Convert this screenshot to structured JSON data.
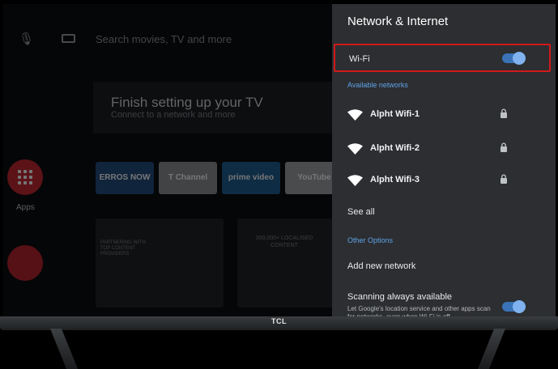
{
  "home": {
    "search_placeholder": "Search movies, TV and more",
    "setup_title": "Finish setting up your TV",
    "setup_subtitle": "Connect to a network and more",
    "apps_label": "Apps",
    "tiles": [
      "ERROS NOW",
      "T Channel",
      "prime video",
      "YouTube"
    ],
    "promo_left_text": "PARTNERING WITH TOP CONTENT PROVIDERS",
    "promo_right_text": "300,000+ LOCALISED CONTENT"
  },
  "panel": {
    "title": "Network & Internet",
    "wifi_label": "Wi-Fi",
    "wifi_enabled": true,
    "available_label": "Available networks",
    "networks": [
      {
        "name": "Alpht Wifi-1",
        "secured": true
      },
      {
        "name": "Alpht Wifi-2",
        "secured": true
      },
      {
        "name": "Alpht Wifi-3",
        "secured": true
      }
    ],
    "see_all": "See all",
    "other_label": "Other Options",
    "add_network": "Add new network",
    "scanning_title": "Scanning always available",
    "scanning_subtitle": "Let Google's location service and other apps scan for networks, even when Wi-Fi is off",
    "scanning_enabled": true
  },
  "tv": {
    "brand": "TCL"
  },
  "colors": {
    "accent": "#3a73b8",
    "highlight": "#d11a1a",
    "section": "#5fa3e8",
    "panel_bg": "#2c2e31"
  }
}
